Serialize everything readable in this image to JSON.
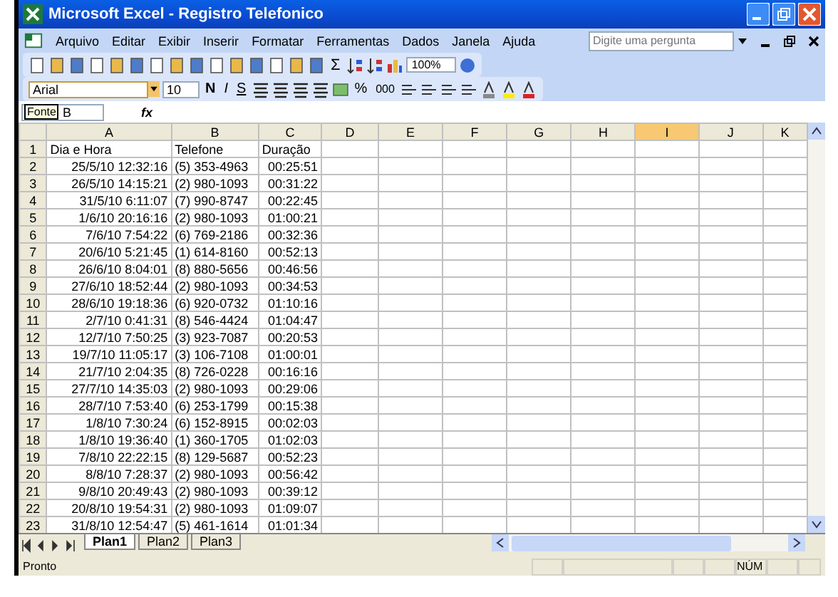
{
  "window": {
    "title": "Microsoft Excel - Registro Telefonico"
  },
  "menu": [
    "Arquivo",
    "Editar",
    "Exibir",
    "Inserir",
    "Formatar",
    "Ferramentas",
    "Dados",
    "Janela",
    "Ajuda"
  ],
  "question": {
    "placeholder": "Digite uma pergunta"
  },
  "standard_toolbar": {
    "sum": "Σ",
    "zoom": "100%"
  },
  "format_toolbar": {
    "font": "Arial",
    "size": "10",
    "bold": "N",
    "italic": "I",
    "underline": "S",
    "percent": "%",
    "thousands": "000"
  },
  "formula_bar": {
    "name_box": "B",
    "tooltip": "Fonte",
    "fx": "fx"
  },
  "columns": [
    {
      "label": "A",
      "selected": false
    },
    {
      "label": "B",
      "selected": false
    },
    {
      "label": "C",
      "selected": false
    },
    {
      "label": "D",
      "selected": false
    },
    {
      "label": "E",
      "selected": false
    },
    {
      "label": "F",
      "selected": false
    },
    {
      "label": "G",
      "selected": false
    },
    {
      "label": "H",
      "selected": false
    },
    {
      "label": "I",
      "selected": true
    },
    {
      "label": "J",
      "selected": false
    },
    {
      "label": "K",
      "selected": false
    }
  ],
  "rows": [
    {
      "n": "1",
      "cells": [
        "Dia e Hora",
        "Telefone",
        "Duração"
      ],
      "kind": "header"
    },
    {
      "n": "2",
      "cells": [
        "25/5/10 12:32:16",
        "(5) 353-4963",
        "00:25:51"
      ],
      "kind": "data"
    },
    {
      "n": "3",
      "cells": [
        "26/5/10 14:15:21",
        "(2) 980-1093",
        "00:31:22"
      ],
      "kind": "data"
    },
    {
      "n": "4",
      "cells": [
        "31/5/10 6:11:07",
        "(7) 990-8747",
        "00:22:45"
      ],
      "kind": "data"
    },
    {
      "n": "5",
      "cells": [
        "1/6/10 20:16:16",
        "(2) 980-1093",
        "01:00:21"
      ],
      "kind": "data"
    },
    {
      "n": "6",
      "cells": [
        "7/6/10 7:54:22",
        "(6) 769-2186",
        "00:32:36"
      ],
      "kind": "data"
    },
    {
      "n": "7",
      "cells": [
        "20/6/10 5:21:45",
        "(1) 614-8160",
        "00:52:13"
      ],
      "kind": "data"
    },
    {
      "n": "8",
      "cells": [
        "26/6/10 8:04:01",
        "(8) 880-5656",
        "00:46:56"
      ],
      "kind": "data"
    },
    {
      "n": "9",
      "cells": [
        "27/6/10 18:52:44",
        "(2) 980-1093",
        "00:34:53"
      ],
      "kind": "data"
    },
    {
      "n": "10",
      "cells": [
        "28/6/10 19:18:36",
        "(6) 920-0732",
        "01:10:16"
      ],
      "kind": "data"
    },
    {
      "n": "11",
      "cells": [
        "2/7/10 0:41:31",
        "(8) 546-4424",
        "01:04:47"
      ],
      "kind": "data"
    },
    {
      "n": "12",
      "cells": [
        "12/7/10 7:50:25",
        "(3) 923-7087",
        "00:20:53"
      ],
      "kind": "data"
    },
    {
      "n": "13",
      "cells": [
        "19/7/10 11:05:17",
        "(3) 106-7108",
        "01:00:01"
      ],
      "kind": "data"
    },
    {
      "n": "14",
      "cells": [
        "21/7/10 2:04:35",
        "(8) 726-0228",
        "00:16:16"
      ],
      "kind": "data"
    },
    {
      "n": "15",
      "cells": [
        "27/7/10 14:35:03",
        "(2) 980-1093",
        "00:29:06"
      ],
      "kind": "data"
    },
    {
      "n": "16",
      "cells": [
        "28/7/10 7:53:40",
        "(6) 253-1799",
        "00:15:38"
      ],
      "kind": "data"
    },
    {
      "n": "17",
      "cells": [
        "1/8/10 7:30:24",
        "(6) 152-8915",
        "00:02:03"
      ],
      "kind": "data"
    },
    {
      "n": "18",
      "cells": [
        "1/8/10 19:36:40",
        "(1) 360-1705",
        "01:02:03"
      ],
      "kind": "data"
    },
    {
      "n": "19",
      "cells": [
        "7/8/10 22:22:15",
        "(8) 129-5687",
        "00:52:23"
      ],
      "kind": "data"
    },
    {
      "n": "20",
      "cells": [
        "8/8/10 7:28:37",
        "(2) 980-1093",
        "00:56:42"
      ],
      "kind": "data"
    },
    {
      "n": "21",
      "cells": [
        "9/8/10 20:49:43",
        "(2) 980-1093",
        "00:39:12"
      ],
      "kind": "data"
    },
    {
      "n": "22",
      "cells": [
        "20/8/10 19:54:31",
        "(2) 980-1093",
        "01:09:07"
      ],
      "kind": "data"
    },
    {
      "n": "23",
      "cells": [
        "31/8/10 12:54:47",
        "(5) 461-1614",
        "01:01:34"
      ],
      "kind": "data"
    }
  ],
  "sheet_tabs": [
    {
      "label": "Plan1",
      "selected": true
    },
    {
      "label": "Plan2",
      "selected": false
    },
    {
      "label": "Plan3",
      "selected": false
    }
  ],
  "status_bar": {
    "text": "Pronto",
    "num": "NÚM"
  }
}
